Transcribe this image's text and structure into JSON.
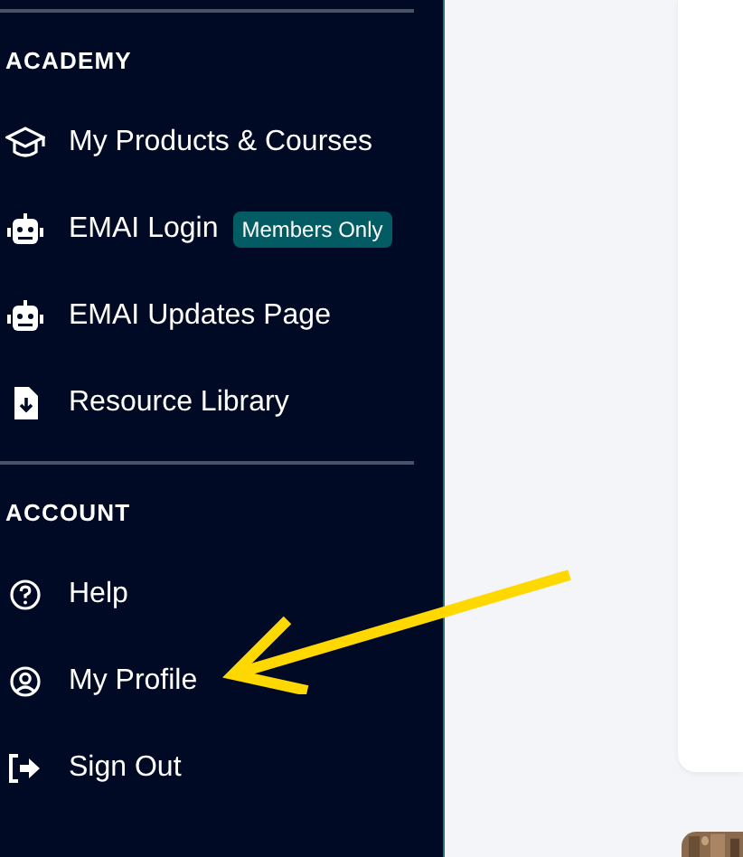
{
  "sidebar": {
    "sections": [
      {
        "heading": "ACADEMY",
        "items": [
          {
            "label": "My Products & Courses"
          },
          {
            "label": "EMAI Login",
            "badge": "Members Only"
          },
          {
            "label": "EMAI Updates Page"
          },
          {
            "label": "Resource Library"
          }
        ]
      },
      {
        "heading": "ACCOUNT",
        "items": [
          {
            "label": "Help"
          },
          {
            "label": "My Profile"
          },
          {
            "label": "Sign Out"
          }
        ]
      }
    ]
  }
}
